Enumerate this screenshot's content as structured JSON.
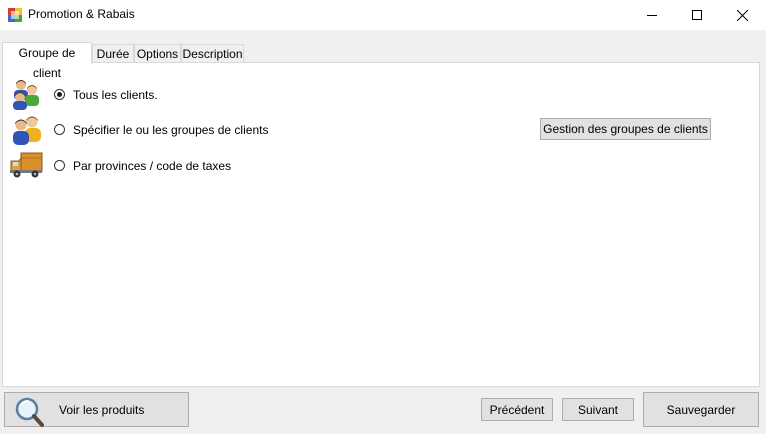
{
  "window": {
    "title": "Promotion & Rabais",
    "icon": "app-icon",
    "controls": [
      "minimize-icon",
      "maximize-icon",
      "close-icon"
    ]
  },
  "tabs": [
    {
      "label": "Groupe de client",
      "active": true
    },
    {
      "label": "Durée",
      "active": false
    },
    {
      "label": "Options",
      "active": false
    },
    {
      "label": "Description",
      "active": false
    }
  ],
  "customer_options": {
    "all_clients": {
      "label": "Tous les clients.",
      "checked": true,
      "icon": "users-group-icon"
    },
    "specific_groups": {
      "label": "Spécifier le ou les groupes de clients",
      "checked": false,
      "icon": "users-group-icon"
    },
    "by_province": {
      "label": "Par provinces / code de taxes",
      "checked": false,
      "icon": "delivery-truck-icon"
    },
    "manage_groups_button": "Gestion des groupes de clients"
  },
  "footer": {
    "view_products": "Voir les produits",
    "previous": "Précédent",
    "next": "Suivant",
    "save": "Sauvegarder"
  },
  "colors": {
    "background": "#f0f0f0",
    "panel": "#ffffff",
    "button_face": "#e1e1e1",
    "button_border": "#adadad"
  }
}
